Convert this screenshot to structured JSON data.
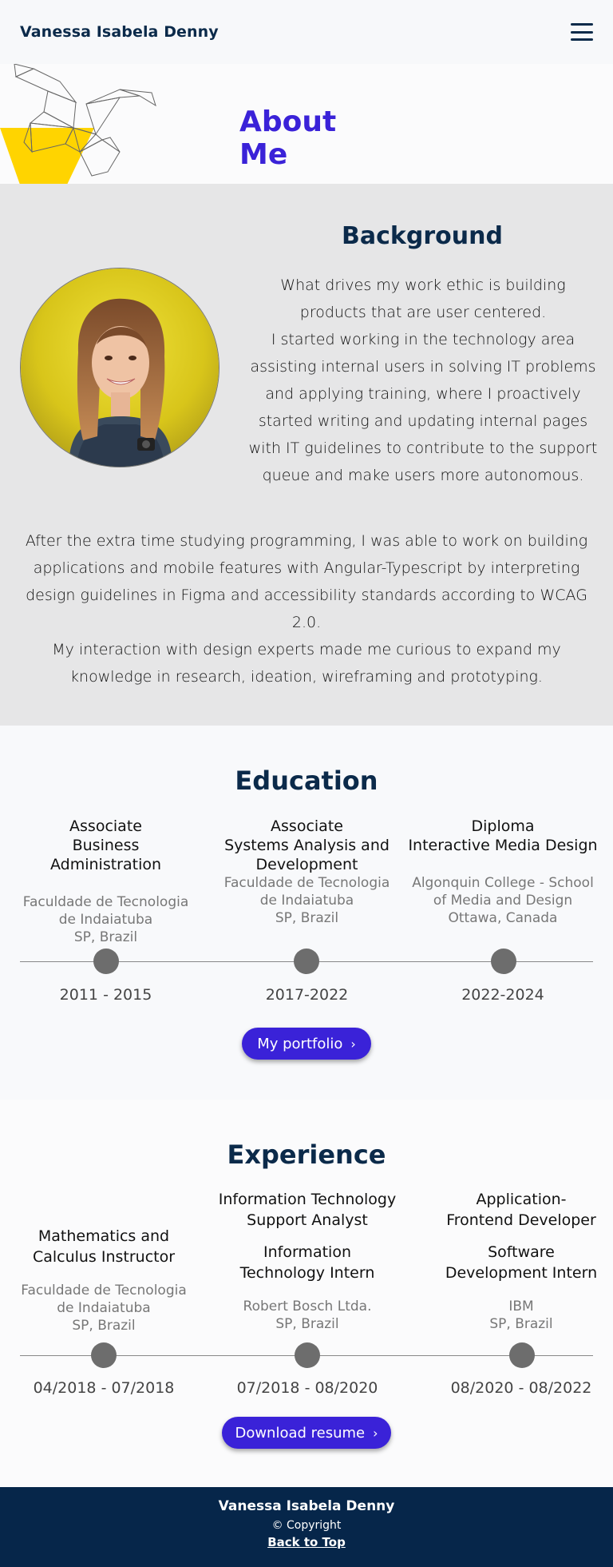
{
  "header": {
    "brand": "Vanessa Isabela Denny",
    "menu_icon": "hamburger-menu-icon"
  },
  "hero": {
    "title": "About Me"
  },
  "background": {
    "title": "Background",
    "paragraph1": "What drives my work ethic is building products that are user centered.",
    "paragraph2": "I started working in the technology area assisting internal users  in solving IT problems and applying training, where I proactively started writing and updating internal pages with IT guidelines to contribute to the support queue and make users more autonomous.",
    "paragraph3": "After the extra time studying programming, I was able to work on building applications and mobile features with Angular-Typescript by interpreting design guidelines in Figma and accessibility standards according to WCAG 2.0.",
    "paragraph4": "My interaction with design experts made me curious to expand my knowledge in research, ideation, wireframing and prototyping."
  },
  "education": {
    "title": "Education",
    "items": [
      {
        "degree1": "Associate",
        "degree2": "Business Administration",
        "school1": "Faculdade de Tecnologia",
        "school2": "de Indaiatuba",
        "school3": "SP, Brazil",
        "years": "2011 - 2015"
      },
      {
        "degree1": "Associate",
        "degree2": "Systems Analysis and",
        "degree3": "Development",
        "school1": "Faculdade de Tecnologia",
        "school2": "de Indaiatuba",
        "school3": "SP, Brazil",
        "years": "2017-2022"
      },
      {
        "degree1": "Diploma",
        "degree2": "Interactive Media Design",
        "school1": "Algonquin College - School",
        "school2": "of Media and Design",
        "school3": "Ottawa, Canada",
        "years": "2022-2024"
      }
    ],
    "button": "My portfolio"
  },
  "experience": {
    "title": "Experience",
    "items": [
      {
        "role1": "Mathematics and",
        "role2": "Calculus Instructor",
        "company1": "Faculdade de Tecnologia",
        "company2": "de Indaiatuba",
        "company3": "SP, Brazil",
        "dates": "04/2018 - 07/2018"
      },
      {
        "role_a1": "Information Technology",
        "role_a2": "Support Analyst",
        "role1": "Information",
        "role2": "Technology Intern",
        "company1": "Robert Bosch Ltda.",
        "company2": "SP, Brazil",
        "dates": "07/2018 - 08/2020"
      },
      {
        "role_a1": "Application-",
        "role_a2": "Frontend Developer",
        "role1": "Software",
        "role2": "Development Intern",
        "company1": "IBM",
        "company2": "SP, Brazil",
        "dates": "08/2020 - 08/2022"
      }
    ],
    "button": "Download resume"
  },
  "footer": {
    "name": "Vanessa Isabela Denny",
    "copyright": "© Copyright",
    "back_to_top": "Back to Top"
  },
  "colors": {
    "accent": "#3a22d8",
    "navy": "#0b2a4a",
    "yellow": "#ffd400",
    "footer": "#06264a"
  }
}
